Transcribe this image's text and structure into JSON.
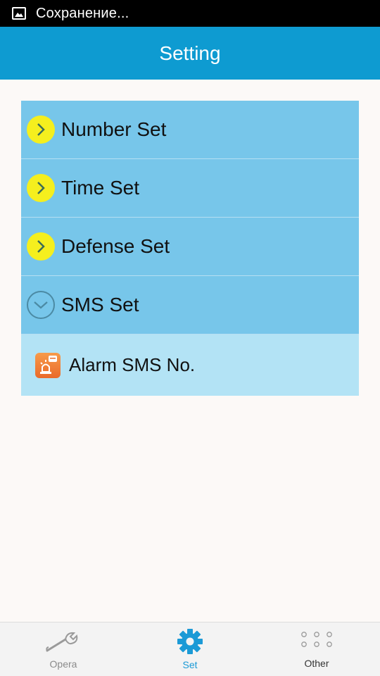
{
  "status_bar": {
    "text": "Сохранение..."
  },
  "header": {
    "title": "Setting"
  },
  "menu": {
    "items": [
      {
        "label": "Number Set",
        "state": "collapsed"
      },
      {
        "label": "Time Set",
        "state": "collapsed"
      },
      {
        "label": "Defense Set",
        "state": "collapsed"
      },
      {
        "label": "SMS Set",
        "state": "expanded"
      }
    ],
    "sub_items": [
      {
        "label": "Alarm SMS No.",
        "icon": "alarm-sms-icon"
      }
    ]
  },
  "tabbar": {
    "tabs": [
      {
        "label": "Opera",
        "icon": "wrench-icon",
        "active": false
      },
      {
        "label": "Set",
        "icon": "gear-icon",
        "active": true
      },
      {
        "label": "Other",
        "icon": "dots-grid-icon",
        "active": false
      }
    ]
  },
  "colors": {
    "header": "#0e9bd1",
    "menu_item": "#77c6ea",
    "sub_item": "#b3e3f5",
    "arrow_yellow": "#f5ef1e",
    "active_tab": "#1b9ad6"
  }
}
